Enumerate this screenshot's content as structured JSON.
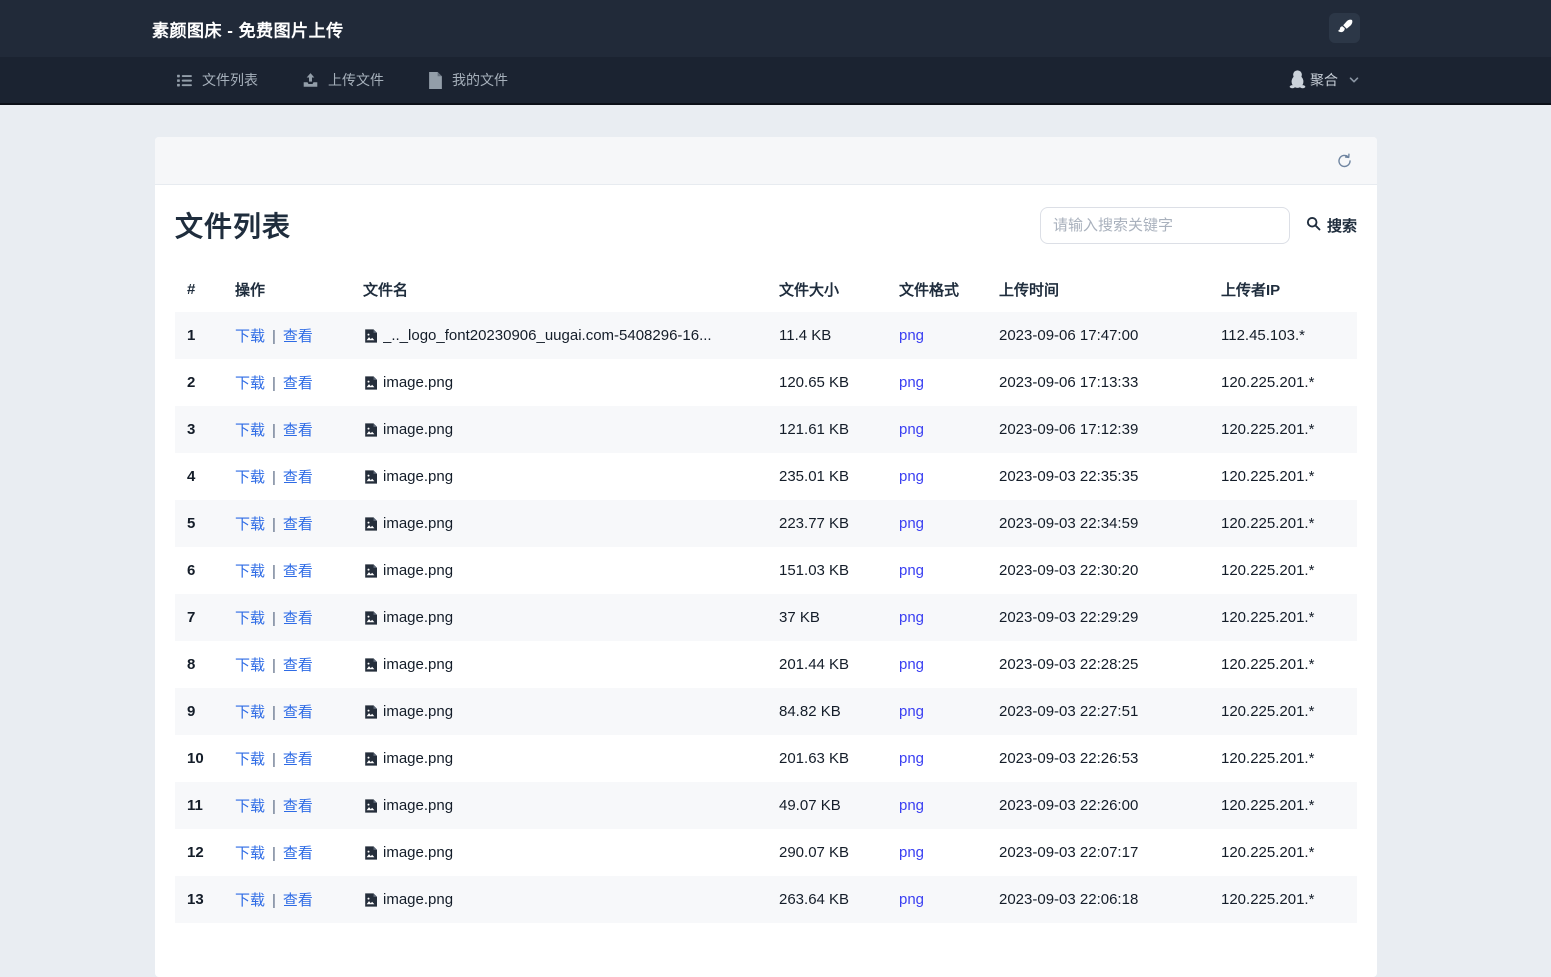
{
  "colors": {
    "topbar_bg": "#212a39",
    "navbar_bg": "#1b2331",
    "page_bg": "#e9edf2",
    "stripe_bg": "#f7f8fa",
    "action_link": "#2e6be5",
    "format_link": "#3a3ff2"
  },
  "header": {
    "title": "素颜图床 - 免费图片上传",
    "theme_button_icon": "brush-icon"
  },
  "nav": {
    "items": [
      {
        "label": "文件列表",
        "icon": "list-icon"
      },
      {
        "label": "上传文件",
        "icon": "upload-icon"
      },
      {
        "label": "我的文件",
        "icon": "file-icon"
      }
    ],
    "user": {
      "label": "聚合",
      "avatar_icon": "penguin-avatar-icon",
      "chevron_icon": "chevron-down-icon"
    }
  },
  "card": {
    "title": "文件列表",
    "refresh_icon": "refresh-icon",
    "search": {
      "placeholder": "请输入搜索关键字",
      "button_label": "搜索",
      "button_icon": "search-icon"
    }
  },
  "table": {
    "columns": [
      "#",
      "操作",
      "文件名",
      "文件大小",
      "文件格式",
      "上传时间",
      "上传者IP"
    ],
    "action_labels": {
      "download": "下载",
      "separator": "|",
      "view": "查看"
    },
    "rows": [
      {
        "index": "1",
        "filename": "_.._logo_font20230906_uugai.com-5408296-16...",
        "size": "11.4 KB",
        "format": "png",
        "time": "2023-09-06 17:47:00",
        "ip": "112.45.103.*"
      },
      {
        "index": "2",
        "filename": "image.png",
        "size": "120.65 KB",
        "format": "png",
        "time": "2023-09-06 17:13:33",
        "ip": "120.225.201.*"
      },
      {
        "index": "3",
        "filename": "image.png",
        "size": "121.61 KB",
        "format": "png",
        "time": "2023-09-06 17:12:39",
        "ip": "120.225.201.*"
      },
      {
        "index": "4",
        "filename": "image.png",
        "size": "235.01 KB",
        "format": "png",
        "time": "2023-09-03 22:35:35",
        "ip": "120.225.201.*"
      },
      {
        "index": "5",
        "filename": "image.png",
        "size": "223.77 KB",
        "format": "png",
        "time": "2023-09-03 22:34:59",
        "ip": "120.225.201.*"
      },
      {
        "index": "6",
        "filename": "image.png",
        "size": "151.03 KB",
        "format": "png",
        "time": "2023-09-03 22:30:20",
        "ip": "120.225.201.*"
      },
      {
        "index": "7",
        "filename": "image.png",
        "size": "37 KB",
        "format": "png",
        "time": "2023-09-03 22:29:29",
        "ip": "120.225.201.*"
      },
      {
        "index": "8",
        "filename": "image.png",
        "size": "201.44 KB",
        "format": "png",
        "time": "2023-09-03 22:28:25",
        "ip": "120.225.201.*"
      },
      {
        "index": "9",
        "filename": "image.png",
        "size": "84.82 KB",
        "format": "png",
        "time": "2023-09-03 22:27:51",
        "ip": "120.225.201.*"
      },
      {
        "index": "10",
        "filename": "image.png",
        "size": "201.63 KB",
        "format": "png",
        "time": "2023-09-03 22:26:53",
        "ip": "120.225.201.*"
      },
      {
        "index": "11",
        "filename": "image.png",
        "size": "49.07 KB",
        "format": "png",
        "time": "2023-09-03 22:26:00",
        "ip": "120.225.201.*"
      },
      {
        "index": "12",
        "filename": "image.png",
        "size": "290.07 KB",
        "format": "png",
        "time": "2023-09-03 22:07:17",
        "ip": "120.225.201.*"
      },
      {
        "index": "13",
        "filename": "image.png",
        "size": "263.64 KB",
        "format": "png",
        "time": "2023-09-03 22:06:18",
        "ip": "120.225.201.*"
      }
    ]
  }
}
